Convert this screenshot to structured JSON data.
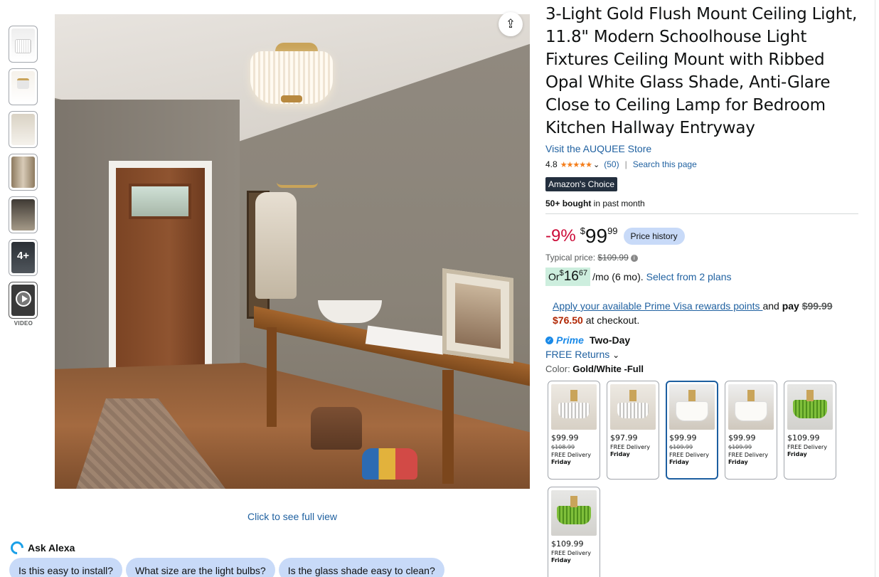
{
  "gallery": {
    "more_label": "4+",
    "video_label": "VIDEO",
    "full_view_link": "Click to see full view"
  },
  "product": {
    "title": "3-Light Gold Flush Mount Ceiling Light, 11.8\" Modern Schoolhouse Light Fixtures Ceiling Mount with Ribbed Opal White Glass Shade, Anti-Glare Close to Ceiling Lamp for Bedroom Kitchen Hallway Entryway",
    "store_link": "Visit the AUQUEE Store",
    "rating": "4.8",
    "stars": "★★★★★",
    "review_count": "(50)",
    "search_page": "Search this page",
    "badge": "Amazon's Choice",
    "bought_bold": "50+ bought",
    "bought_rest": " in past month"
  },
  "pricing": {
    "discount": "-9%",
    "currency": "$",
    "whole": "99",
    "fraction": "99",
    "price_history_button": "Price history",
    "typical_label": "Typical price: ",
    "typical_value": "$109.99",
    "monthly_prefix": "Or ",
    "monthly_currency": "$",
    "monthly_whole": "16",
    "monthly_fraction": "67",
    "monthly_suffix": "/mo (6 mo).",
    "plans_link": "Select from 2 plans"
  },
  "prime_visa": {
    "link": "Apply your available Prime Visa rewards points ",
    "and": "and ",
    "pay": "pay",
    "old": "$99.99",
    "new": "$76.50",
    "tail": " at checkout."
  },
  "delivery": {
    "prime": "Prime",
    "two_day": "Two-Day",
    "returns": "FREE Returns"
  },
  "color": {
    "label": "Color: ",
    "value": "Gold/White -Full"
  },
  "swatches": [
    {
      "price": "$99.99",
      "strike": "$108.99",
      "delivery": "FREE Delivery",
      "day": "Friday"
    },
    {
      "price": "$97.99",
      "strike": "",
      "delivery": "FREE Delivery",
      "day": "Friday"
    },
    {
      "price": "$99.99",
      "strike": "$109.99",
      "delivery": "FREE Delivery",
      "day": "Friday"
    },
    {
      "price": "$99.99",
      "strike": "$109.99",
      "delivery": "FREE Delivery",
      "day": "Friday"
    },
    {
      "price": "$109.99",
      "strike": "",
      "delivery": "FREE Delivery",
      "day": "Friday"
    },
    {
      "price": "$109.99",
      "strike": "",
      "delivery": "FREE Delivery",
      "day": "Friday"
    }
  ],
  "alexa": {
    "title": "Ask Alexa",
    "questions": [
      "Is this easy to install?",
      "What size are the light bulbs?",
      "Is the glass shade easy to clean?"
    ]
  },
  "colors": {
    "link": "#2162a1",
    "discount": "#cc0c39",
    "badge_bg": "#232f3e",
    "chip_bg": "#c8daf8",
    "star": "#f47d1a"
  }
}
